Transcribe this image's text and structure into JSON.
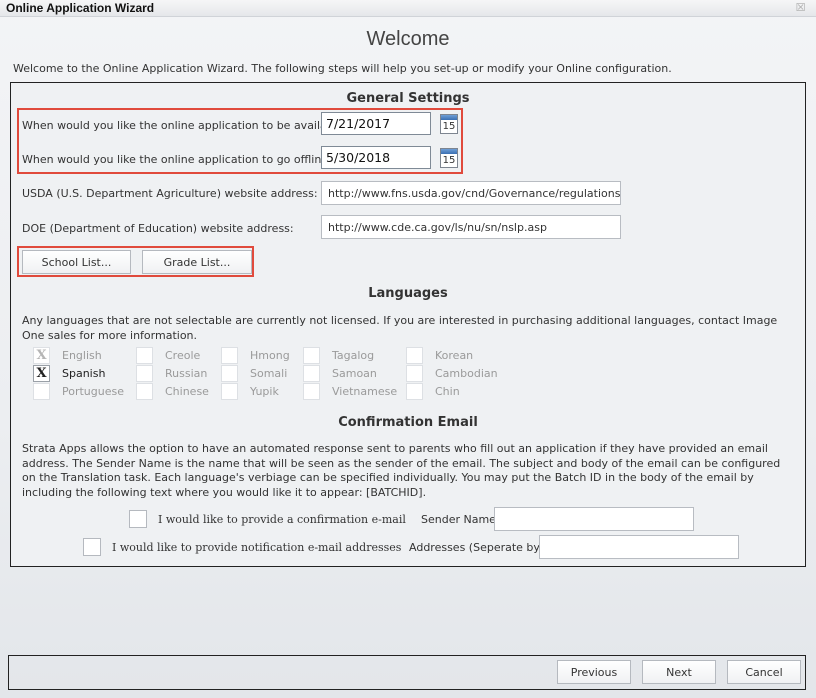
{
  "window": {
    "title": "Online Application Wizard",
    "close_icon": "close-icon"
  },
  "header": {
    "heading": "Welcome",
    "intro": "Welcome to the Online Application Wizard. The following steps will help you set-up or modify your Online configuration."
  },
  "general_settings": {
    "title": "General Settings",
    "available_label": "When would you like the online application to be available?",
    "available_date": "7/21/2017",
    "offline_label": "When would you like the online application to go offline?",
    "offline_date": "5/30/2018",
    "calendar_icon_text": "15",
    "usda_label": "USDA (U.S. Department Agriculture) website address:",
    "usda_url": "http://www.fns.usda.gov/cnd/Governance/regulations.htm",
    "doe_label": "DOE (Department of Education) website address:",
    "doe_url": "http://www.cde.ca.gov/ls/nu/sn/nslp.asp",
    "school_list_button": "School List...",
    "grade_list_button": "Grade List..."
  },
  "languages": {
    "title": "Languages",
    "description": "Any languages that are not selectable are currently not licensed. If you are interested in purchasing additional languages, contact Image One sales for more information.",
    "items": [
      {
        "label": "English",
        "checked": true,
        "enabled": false
      },
      {
        "label": "Spanish",
        "checked": true,
        "enabled": true
      },
      {
        "label": "Portuguese",
        "checked": false,
        "enabled": false
      },
      {
        "label": "Creole",
        "checked": false,
        "enabled": false
      },
      {
        "label": "Russian",
        "checked": false,
        "enabled": false
      },
      {
        "label": "Chinese",
        "checked": false,
        "enabled": false
      },
      {
        "label": "Hmong",
        "checked": false,
        "enabled": false
      },
      {
        "label": "Somali",
        "checked": false,
        "enabled": false
      },
      {
        "label": "Yupik",
        "checked": false,
        "enabled": false
      },
      {
        "label": "Tagalog",
        "checked": false,
        "enabled": false
      },
      {
        "label": "Samoan",
        "checked": false,
        "enabled": false
      },
      {
        "label": "Vietnamese",
        "checked": false,
        "enabled": false
      },
      {
        "label": "Korean",
        "checked": false,
        "enabled": false
      },
      {
        "label": "Cambodian",
        "checked": false,
        "enabled": false
      },
      {
        "label": "Chin",
        "checked": false,
        "enabled": false
      }
    ],
    "check_mark": "X"
  },
  "confirmation_email": {
    "title": "Confirmation Email",
    "description": "Strata Apps allows the option to have an automated response sent to parents who fill out an application if they have provided an email address. The Sender Name is the name that will be seen as the sender of the email. The subject and body of the email can be configured on the Translation task. Each language's verbiage can be specified individually. You may put the Batch ID in the body of the email by including the following text where you would like it to appear: [BATCHID].",
    "confirm_checkbox_label": "I would like to provide a confirmation e-mail",
    "confirm_checked": false,
    "sender_name_label": "Sender Name:",
    "sender_name_value": "",
    "notify_checkbox_label": "I would like to provide notification e-mail addresses",
    "notify_checked": false,
    "addresses_label": "Addresses (Seperate by ;)",
    "addresses_value": ""
  },
  "footer": {
    "previous_button": "Previous",
    "next_button": "Next",
    "cancel_button": "Cancel"
  },
  "colors": {
    "highlight_border": "#e04a3c",
    "panel_border": "#222222",
    "background": "#eff1f3"
  }
}
